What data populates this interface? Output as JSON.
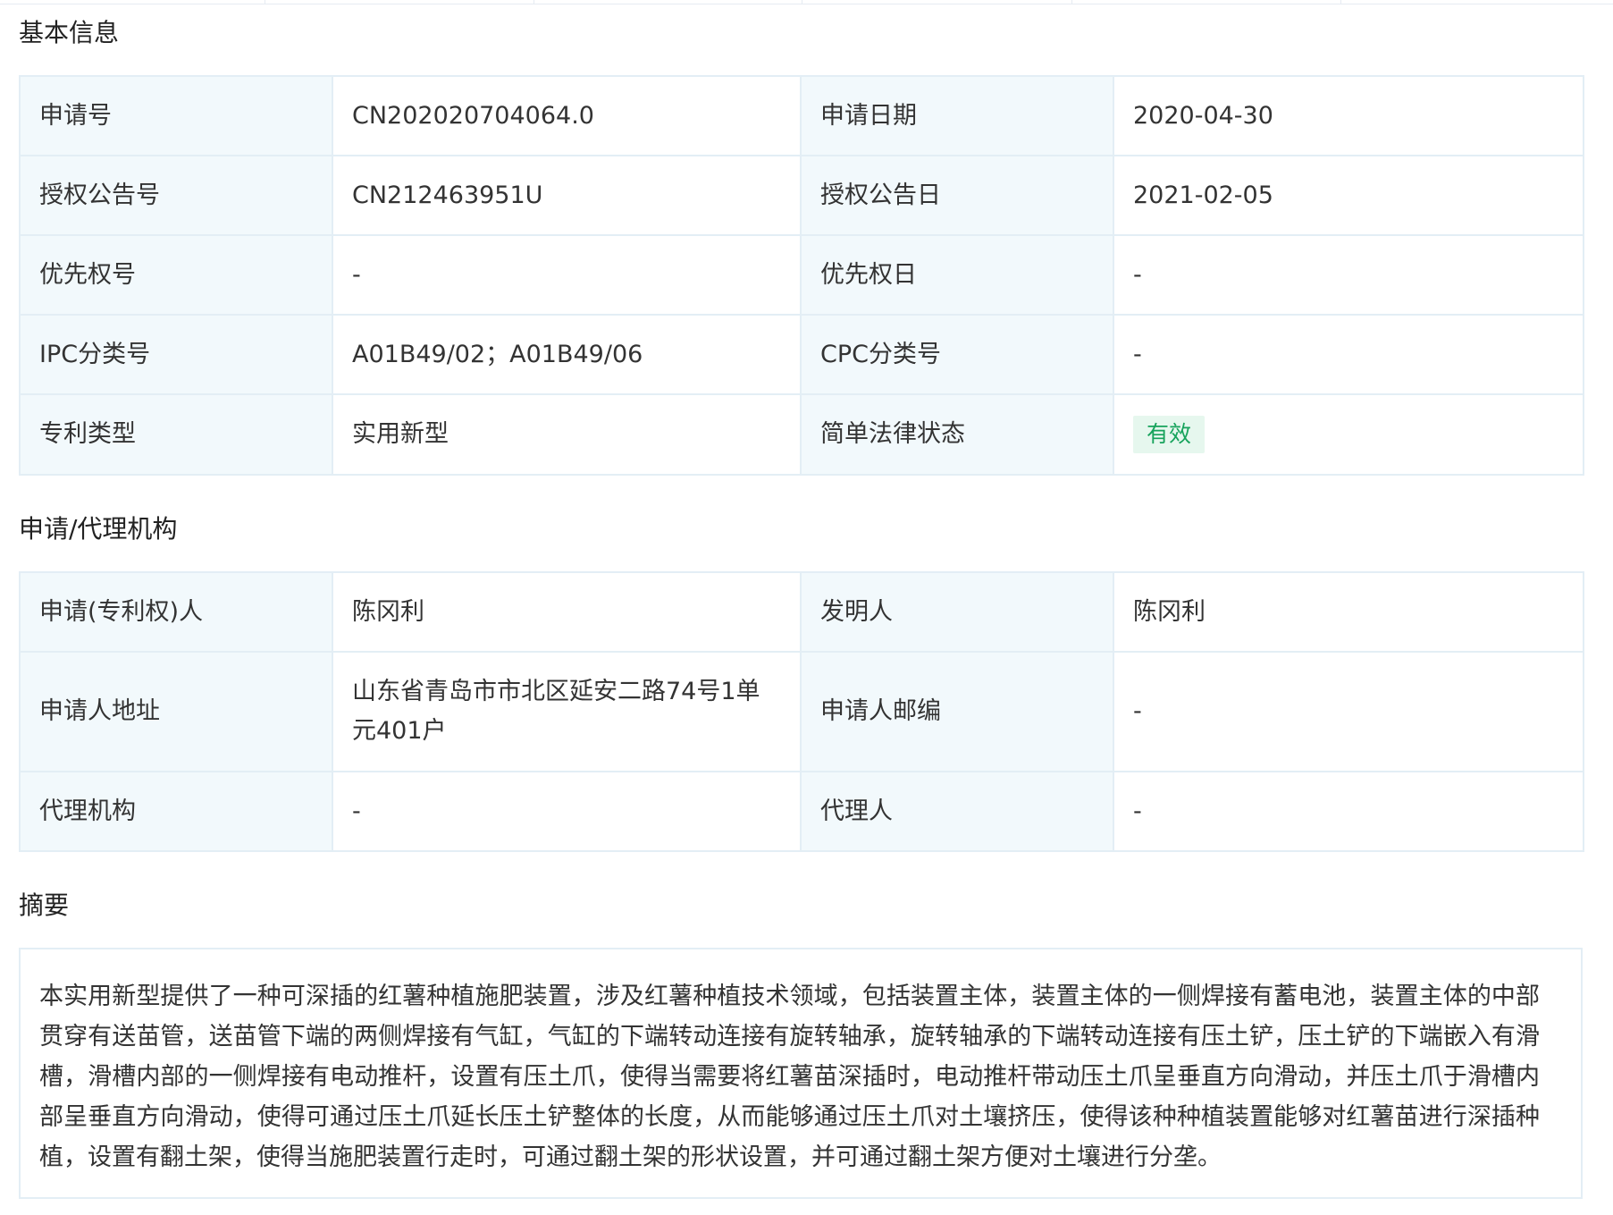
{
  "basic_info": {
    "title": "基本信息",
    "rows": [
      {
        "label1": "申请号",
        "value1": "CN202020704064.0",
        "label2": "申请日期",
        "value2": "2020-04-30"
      },
      {
        "label1": "授权公告号",
        "value1": "CN212463951U",
        "label2": "授权公告日",
        "value2": "2021-02-05"
      },
      {
        "label1": "优先权号",
        "value1": "-",
        "label2": "优先权日",
        "value2": "-"
      },
      {
        "label1": "IPC分类号",
        "value1": "A01B49/02；A01B49/06",
        "label2": "CPC分类号",
        "value2": "-"
      },
      {
        "label1": "专利类型",
        "value1": "实用新型",
        "label2": "简单法律状态",
        "value2": "有效"
      }
    ]
  },
  "agency_info": {
    "title": "申请/代理机构",
    "rows": [
      {
        "label1": "申请(专利权)人",
        "value1": "陈冈利",
        "label2": "发明人",
        "value2": "陈冈利"
      },
      {
        "label1": "申请人地址",
        "value1": "山东省青岛市市北区延安二路74号1单元401户",
        "label2": "申请人邮编",
        "value2": "-"
      },
      {
        "label1": "代理机构",
        "value1": "-",
        "label2": "代理人",
        "value2": "-"
      }
    ]
  },
  "abstract": {
    "title": "摘要",
    "text": "本实用新型提供了一种可深插的红薯种植施肥装置，涉及红薯种植技术领域，包括装置主体，装置主体的一侧焊接有蓄电池，装置主体的中部贯穿有送苗管，送苗管下端的两侧焊接有气缸，气缸的下端转动连接有旋转轴承，旋转轴承的下端转动连接有压土铲，压土铲的下端嵌入有滑槽，滑槽内部的一侧焊接有电动推杆，设置有压土爪，使得当需要将红薯苗深插时，电动推杆带动压土爪呈垂直方向滑动，并压土爪于滑槽内部呈垂直方向滑动，使得可通过压土爪延长压土铲整体的长度，从而能够通过压土爪对土壤挤压，使得该种种植装置能够对红薯苗进行深插种植，设置有翻土架，使得当施肥装置行走时，可通过翻土架的形状设置，并可通过翻土架方便对土壤进行分垄。"
  },
  "colors": {
    "label_bg": "#f2f9fc",
    "border": "#e3eef5",
    "status_badge_bg": "#e6f7ee",
    "status_badge_text": "#17a35c"
  }
}
